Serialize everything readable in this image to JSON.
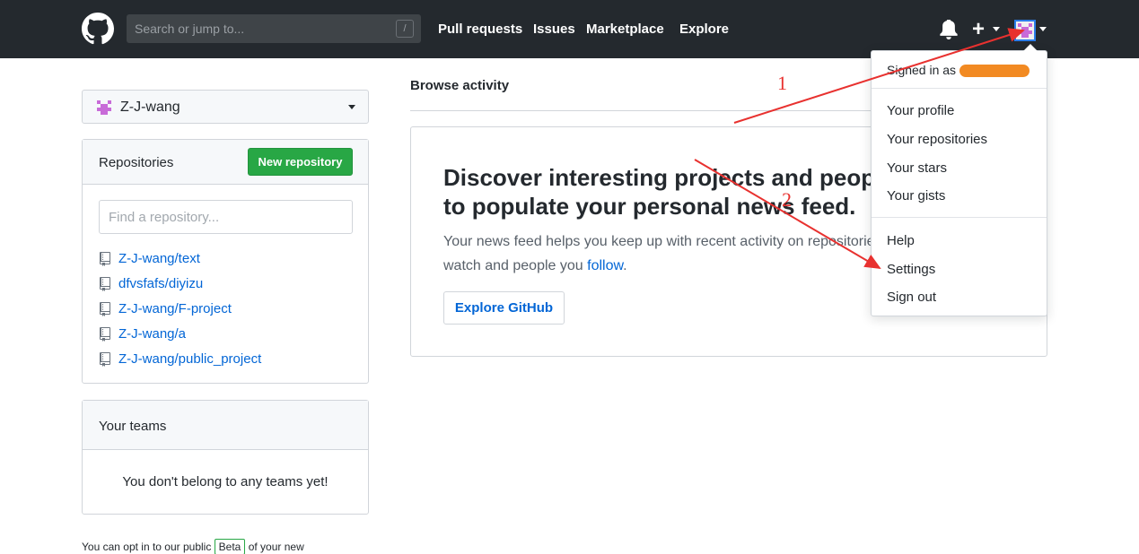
{
  "header": {
    "search_placeholder": "Search or jump to...",
    "slash_hint": "/",
    "nav": [
      "Pull requests",
      "Issues",
      "Marketplace",
      "Explore"
    ]
  },
  "sidebar": {
    "account_name": "Z-J-wang",
    "repositories": {
      "title": "Repositories",
      "new_button": "New repository",
      "find_placeholder": "Find a repository...",
      "items": [
        "Z-J-wang/text",
        "dfvsfafs/diyizu",
        "Z-J-wang/F-project",
        "Z-J-wang/a",
        "Z-J-wang/public_project"
      ]
    },
    "teams": {
      "title": "Your teams",
      "empty": "You don't belong to any teams yet!"
    },
    "optin": {
      "prefix": "You can opt in to our public",
      "badge": "Beta",
      "suffix": "of your new"
    }
  },
  "main": {
    "browse_title": "Browse activity",
    "discover": {
      "heading": "Discover interesting projects and people to populate your personal news feed.",
      "text_before": "Your news feed helps you keep up with recent activity on repositories you watch and people you",
      "link": "follow",
      "text_after": ".",
      "button": "Explore GitHub"
    }
  },
  "dropdown": {
    "signed_in": "Signed in as",
    "items_1": [
      "Your profile",
      "Your repositories",
      "Your stars",
      "Your gists"
    ],
    "items_2": [
      "Help",
      "Settings",
      "Sign out"
    ]
  },
  "annotations": {
    "label_1": "1",
    "label_2": "2",
    "arrow_color": "#e8312f"
  },
  "colors": {
    "header_bg": "#24292e",
    "link": "#0366d6",
    "primary_button": "#28a745"
  }
}
